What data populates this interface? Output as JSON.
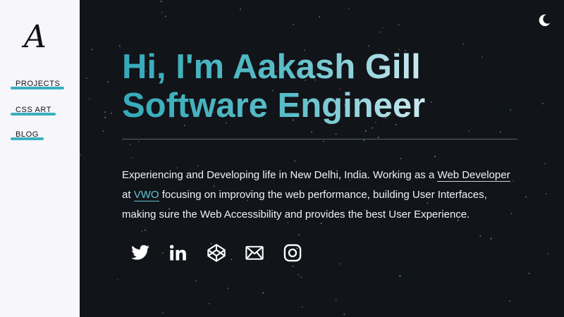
{
  "sidebar": {
    "logo": "A",
    "nav": [
      {
        "label": "PROJECTS"
      },
      {
        "label": "CSS ART"
      },
      {
        "label": "BLOG"
      }
    ]
  },
  "hero": {
    "line1": "Hi, I'm Aakash Gill",
    "line2": "Software Engineer"
  },
  "bio": {
    "part1": "Experiencing and Developing life in New Delhi, India. Working as a ",
    "link_role": "Web Developer",
    "part2": " at ",
    "link_company": "VWO",
    "part3": " focusing on improving the web performance, building User Interfaces, making sure the Web Accessibility and provides the best User Experience."
  },
  "socials": [
    {
      "icon": "twitter-icon"
    },
    {
      "icon": "linkedin-icon"
    },
    {
      "icon": "codepen-icon"
    },
    {
      "icon": "mail-icon"
    },
    {
      "icon": "instagram-icon"
    }
  ],
  "theme": {
    "toggle_icon": "moon-icon",
    "accent": "#3bb0bf",
    "background": "#111419",
    "sidebar_bg": "#f6f6fb"
  }
}
